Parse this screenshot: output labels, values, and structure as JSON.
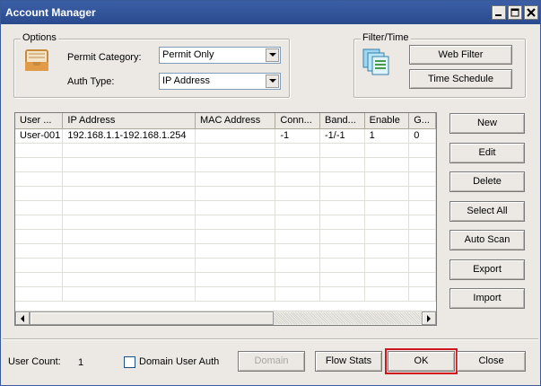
{
  "window": {
    "title": "Account Manager"
  },
  "options": {
    "group_title": "Options",
    "permit_category_label": "Permit Category:",
    "permit_category_value": "Permit Only",
    "auth_type_label": "Auth Type:",
    "auth_type_value": "IP Address"
  },
  "filter_time": {
    "group_title": "Filter/Time",
    "web_filter_label": "Web Filter",
    "time_schedule_label": "Time Schedule"
  },
  "table": {
    "columns": [
      "User ...",
      "IP Address",
      "MAC Address",
      "Conn...",
      "Band...",
      "Enable",
      "G..."
    ],
    "rows": [
      [
        "User-001",
        "192.168.1.1-192.168.1.254",
        "",
        "-1",
        "-1/-1",
        "1",
        "0"
      ]
    ]
  },
  "side_buttons": {
    "new": "New",
    "edit": "Edit",
    "delete": "Delete",
    "select_all": "Select All",
    "auto_scan": "Auto Scan",
    "export": "Export",
    "import": "Import"
  },
  "footer": {
    "user_count_label": "User Count:",
    "user_count_value": "1",
    "domain_user_auth_label": "Domain User Auth",
    "domain_user_auth_checked": false,
    "domain_label": "Domain",
    "flow_stats_label": "Flow Stats",
    "ok_label": "OK",
    "close_label": "Close"
  },
  "icons": {
    "options": "inbox-tray-icon",
    "filter_time": "stacked-documents-icon",
    "minimize": "minimize-icon",
    "maximize": "maximize-icon",
    "close": "close-icon"
  },
  "colors": {
    "title_bar": "#2f4f98",
    "ok_focus_outline": "#d0161d"
  }
}
